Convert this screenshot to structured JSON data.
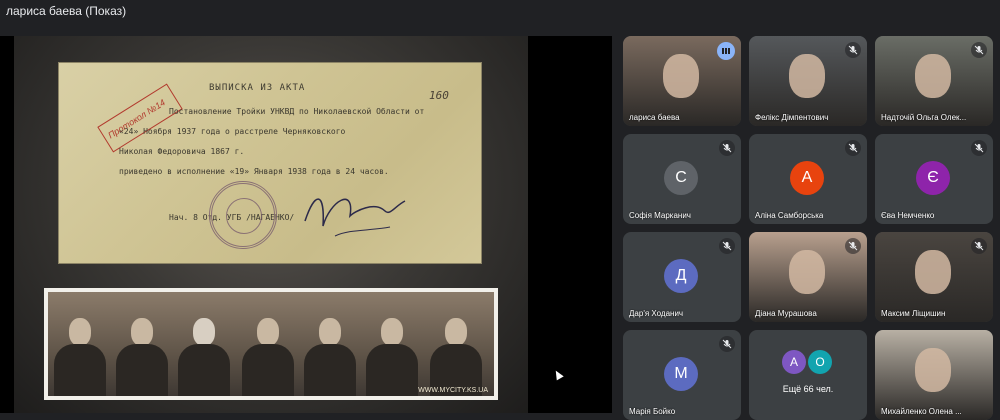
{
  "header": {
    "presenter_title": "лариса баева (Показ)"
  },
  "presentation": {
    "document": {
      "heading": "ВЫПИСКА ИЗ АКТА",
      "stamp_text": "Протокол №14",
      "page_number": "160",
      "lines": [
        "Постановление Тройки УНКВД по Николаевской Области от",
        "«24» Ноября 1937 года о расстреле Черняковского",
        "Николая Федоровича 1867 г.",
        "приведено в исполнение «19» Января 1938 года в 24 часов.",
        "Нач. 8 Отд. УГБ                       /НАГАЕНКО/"
      ]
    },
    "photo_watermark": "WWW.MYCITY.KS.UA"
  },
  "participants": [
    {
      "name": "лариса баева",
      "type": "video",
      "bg": "#7a6a5e",
      "speaking": true,
      "muted": false
    },
    {
      "name": "Фелікс Дімпентович",
      "type": "video",
      "bg": "#55585b",
      "muted": true
    },
    {
      "name": "Надточій Ольга Олек...",
      "type": "video",
      "bg": "#6a6d66",
      "muted": true
    },
    {
      "name": "Софія Марканич",
      "type": "avatar",
      "initial": "С",
      "avatar_color": "#5f6368",
      "muted": true
    },
    {
      "name": "Аліна Самборська",
      "type": "avatar",
      "initial": "А",
      "avatar_color": "#e8430e",
      "muted": true
    },
    {
      "name": "Єва Немченко",
      "type": "avatar",
      "initial": "Є",
      "avatar_color": "#8e24aa",
      "muted": true
    },
    {
      "name": "Дар'я Ходанич",
      "type": "avatar",
      "initial": "Д",
      "avatar_color": "#5c6bc0",
      "muted": true
    },
    {
      "name": "Діана Мурашова",
      "type": "video",
      "bg": "#b8a08e",
      "muted": true
    },
    {
      "name": "Максим Ліщишин",
      "type": "video",
      "bg": "#4a4540",
      "muted": true
    },
    {
      "name": "Марія Бойко",
      "type": "avatar",
      "initial": "М",
      "avatar_color": "#5c6bc0",
      "muted": true
    },
    {
      "name": "Ещё 66 чел.",
      "type": "more",
      "initials": [
        "А",
        "О"
      ],
      "colors": [
        "#7e57c2",
        "#12a4af"
      ]
    },
    {
      "name": "Михайленко Олена ...",
      "type": "video",
      "bg": "#b8b0a4",
      "muted": false
    }
  ],
  "colors": {
    "background": "#202124",
    "tile": "#3c4043",
    "accent": "#8ab4f8"
  }
}
